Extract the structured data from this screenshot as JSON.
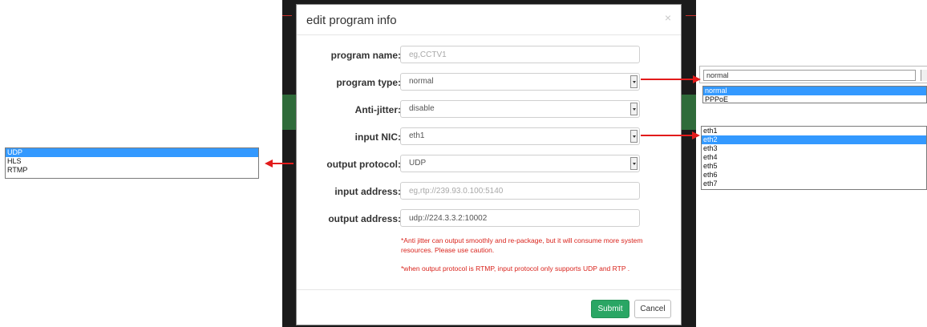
{
  "modal": {
    "title": "edit program info",
    "close_glyph": "×",
    "fields": {
      "program_name": {
        "label": "program name:",
        "placeholder": "eg,CCTV1"
      },
      "program_type": {
        "label": "program type:",
        "value": "normal"
      },
      "anti_jitter": {
        "label": "Anti-jitter:",
        "value": "disable"
      },
      "input_nic": {
        "label": "input NIC:",
        "value": "eth1"
      },
      "output_protocol": {
        "label": "output protocol:",
        "value": "UDP"
      },
      "input_address": {
        "label": "input address:",
        "placeholder": "eg,rtp://239.93.0.100:5140"
      },
      "output_address": {
        "label": "output address:",
        "value": "udp://224.3.3.2:10002"
      }
    },
    "notes": {
      "jitter": "*Anti jitter can output smoothly and re-package, but it will consume more system resources. Please use caution.",
      "rtmp": "*when output protocol is RTMP, input protocol only supports UDP and RTP ."
    },
    "buttons": {
      "submit": "Submit",
      "cancel": "Cancel"
    }
  },
  "protocol_dropdown": {
    "items": [
      "UDP",
      "HLS",
      "RTMP"
    ],
    "selected": "UDP"
  },
  "type_dropdown": {
    "current": "normal",
    "items": [
      "normal",
      "PPPoE"
    ],
    "selected": "normal"
  },
  "nic_dropdown": {
    "items": [
      "eth1",
      "eth2",
      "eth3",
      "eth4",
      "eth5",
      "eth6",
      "eth7"
    ],
    "selected": "eth2"
  },
  "colors": {
    "submit": "#2aa664",
    "note_text": "#d9231c",
    "selection": "#3399ff",
    "arrow": "#e21b1b"
  },
  "icons": {
    "close": "close-icon",
    "select_arrow": "chevron-down-icon",
    "callout_arrow": "arrow-icon"
  }
}
